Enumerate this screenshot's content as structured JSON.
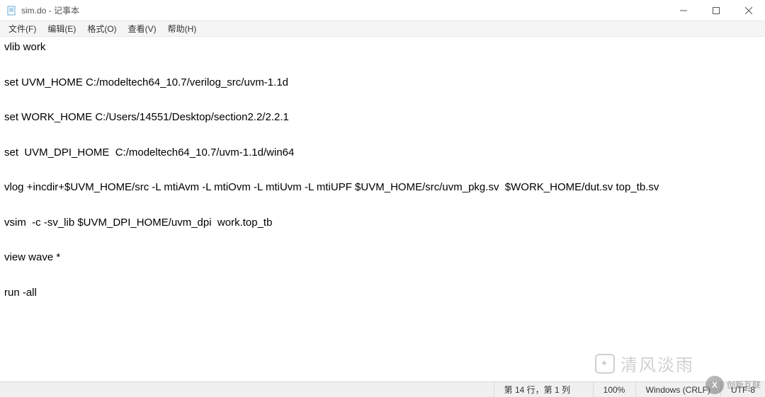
{
  "window": {
    "title": "sim.do - 记事本"
  },
  "menu": {
    "file": "文件(F)",
    "edit": "编辑(E)",
    "format": "格式(O)",
    "view": "查看(V)",
    "help": "帮助(H)"
  },
  "editor": {
    "content": "vlib work\n\nset UVM_HOME C:/modeltech64_10.7/verilog_src/uvm-1.1d\n\nset WORK_HOME C:/Users/14551/Desktop/section2.2/2.2.1\n\nset  UVM_DPI_HOME  C:/modeltech64_10.7/uvm-1.1d/win64\n\nvlog +incdir+$UVM_HOME/src -L mtiAvm -L mtiOvm -L mtiUvm -L mtiUPF $UVM_HOME/src/uvm_pkg.sv  $WORK_HOME/dut.sv top_tb.sv\n\nvsim  -c -sv_lib $UVM_DPI_HOME/uvm_dpi  work.top_tb\n\nview wave *\n\nrun -all"
  },
  "status": {
    "position": "第 14 行，第 1 列",
    "zoom": "100%",
    "eol": "Windows (CRLF)",
    "encoding": "UTF-8"
  },
  "watermark": {
    "text": "清风淡雨",
    "logo_text": "创新互联"
  }
}
